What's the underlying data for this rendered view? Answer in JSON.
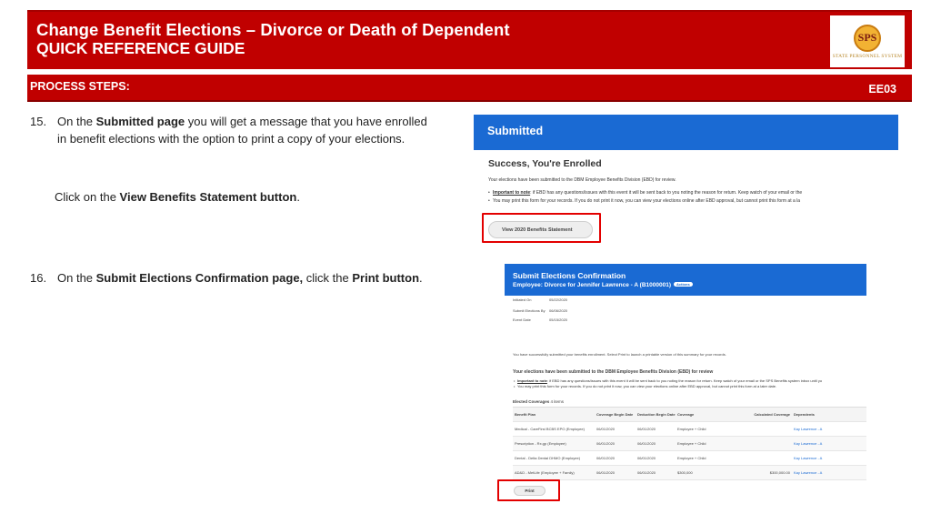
{
  "header": {
    "title": "Change Benefit Elections – Divorce or Death of Dependent",
    "subtitle": "QUICK REFERENCE GUIDE",
    "logo": {
      "initials": "SPS",
      "name": "STATE PERSONNEL SYSTEM",
      "icon": "sps-logo"
    }
  },
  "steps_bar": {
    "label": "PROCESS STEPS:",
    "code": "EE03"
  },
  "steps": [
    {
      "number": "15.",
      "line1_pre": "On the ",
      "line1_bold": "Submitted page",
      "line1_post": " you will get a message that you have enrolled",
      "line2": "in benefit elections with the option to print a copy of your elections.",
      "sub_pre": "Click on the ",
      "sub_bold": "View Benefits Statement button",
      "sub_post": "."
    },
    {
      "number": "16.",
      "pre": "On the ",
      "bold1": "Submit Elections Confirmation page,",
      "mid": " click the ",
      "bold2": "Print button",
      "post": "."
    }
  ],
  "screenshot1": {
    "bar_title": "Submitted",
    "heading": "Success, You're Enrolled",
    "intro": "Your elections have been submitted to the DBM Employee Benefits Division (EBD) for review.",
    "bullet1_bold": "Important to note",
    "bullet1": ": if EBD has any questions/issues with this event it will be sent back to you noting the reason for return.  Keep watch of your email or the",
    "bullet2": "You may print this form for your records.  If you do not print it now, you can view your elections online after EBD approval, but cannot print this form at a la",
    "button": "View 2020 Benefits Statement"
  },
  "screenshot2": {
    "title": "Submit Elections Confirmation",
    "subtitle": "Employee: Divorce for Jennifer Lawrence - A (B1000001)",
    "pill": "Actions",
    "fields": [
      {
        "k": "Initiated On",
        "v": "05/22/2020"
      },
      {
        "k": "Submit Elections By",
        "v": "06/06/2020"
      },
      {
        "k": "Event Date",
        "v": "05/15/2020"
      }
    ],
    "success_msg": "You have successfully submitted your benefits enrollment. Select Print to launch a printable version of this summary for your records.",
    "review_msg": "Your elections have been submitted to the DBM Employee Benefits Division (EBD) for review",
    "bullet1_bold": "Important to note",
    "bullet1": ": if EBD has any questions/issues with this event it will be sent back to you noting the reason for return.  Keep watch of your email or the SPS Benefits system inbox until yo",
    "bullet2": "You may print this form for your records.  If you do not print it now, you can view your elections online after EBD approval, but cannot print this form at a later date.",
    "table_title": "Elected Coverages",
    "table_count": "4 items",
    "columns": [
      "Benefit Plan",
      "Coverage Begin Date",
      "Deduction Begin Date",
      "Coverage",
      "Calculated Coverage",
      "Dependents"
    ],
    "rows": [
      [
        "Medical - CareFirst BCBS EPO (Employee)",
        "06/01/2020",
        "06/01/2020",
        "Employee + Child",
        "",
        "Kay Lawrence - A"
      ],
      [
        "Prescription - Rx.gp (Employee)",
        "06/01/2020",
        "06/01/2020",
        "Employee + Child",
        "",
        "Kay Lawrence - A"
      ],
      [
        "Dental - Delta Dental DHMO (Employee)",
        "06/01/2020",
        "06/01/2020",
        "Employee + Child",
        "",
        "Kay Lawrence - A"
      ],
      [
        "AD&D - MetLife (Employee + Family)",
        "06/01/2020",
        "06/01/2020",
        "$300,000",
        "$300,000.00",
        "Kay Lawrence - A"
      ]
    ],
    "print_button": "Print"
  }
}
